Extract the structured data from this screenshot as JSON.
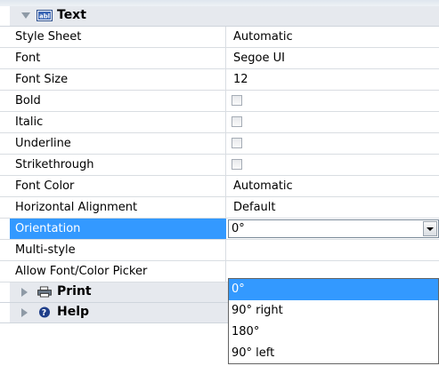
{
  "sections": {
    "text": {
      "label": "Text",
      "icon": "text-field-icon",
      "expanded": true
    },
    "print": {
      "label": "Print",
      "icon": "printer-icon",
      "expanded": false
    },
    "help": {
      "label": "Help",
      "icon": "help-icon",
      "expanded": false
    }
  },
  "properties": [
    {
      "name": "Style Sheet",
      "value": "Automatic",
      "type": "text"
    },
    {
      "name": "Font",
      "value": "Segoe UI",
      "type": "text"
    },
    {
      "name": "Font Size",
      "value": "12",
      "type": "text"
    },
    {
      "name": "Bold",
      "checked": false,
      "type": "checkbox"
    },
    {
      "name": "Italic",
      "checked": false,
      "type": "checkbox"
    },
    {
      "name": "Underline",
      "checked": false,
      "type": "checkbox"
    },
    {
      "name": "Strikethrough",
      "checked": false,
      "type": "checkbox"
    },
    {
      "name": "Font Color",
      "value": "Automatic",
      "type": "text"
    },
    {
      "name": "Horizontal Alignment",
      "value": "Default",
      "type": "text"
    },
    {
      "name": "Orientation",
      "value": "0°",
      "type": "combo",
      "selected": true
    },
    {
      "name": "Multi-style",
      "value": "",
      "type": "text"
    },
    {
      "name": "Allow Font/Color Picker",
      "value": "",
      "type": "text"
    }
  ],
  "orientation_dropdown": {
    "options": [
      "0°",
      "90° right",
      "180°",
      "90° left"
    ],
    "highlighted": "0°"
  },
  "colors": {
    "selection": "#3399ff",
    "header_bg": "#e6e9ee",
    "grid_line": "#d9dde2"
  }
}
